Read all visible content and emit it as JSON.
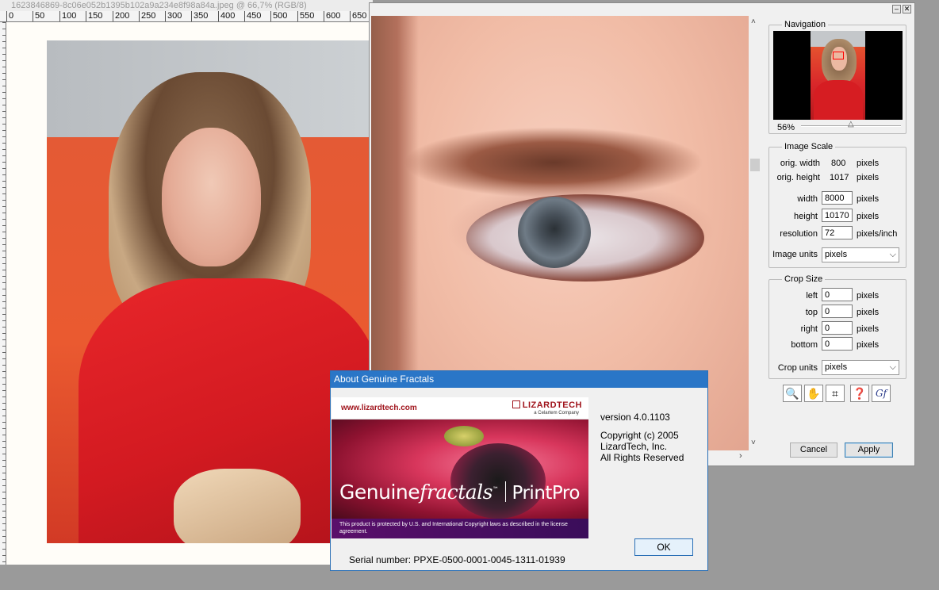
{
  "document": {
    "title": "1623846869-8c06e052b1395b102a9a234e8f98a84a.jpeg @ 66,7% (RGB/8)",
    "ruler_labels": [
      "0",
      "50",
      "100",
      "150",
      "200",
      "250",
      "300",
      "350",
      "400",
      "450",
      "500",
      "550",
      "600",
      "650"
    ]
  },
  "gf_window": {
    "navigation": {
      "label": "Navigation",
      "zoom": "56%"
    },
    "image_scale": {
      "label": "Image Scale",
      "orig_width_label": "orig. width",
      "orig_width_value": "800",
      "orig_width_unit": "pixels",
      "orig_height_label": "orig. height",
      "orig_height_value": "1017",
      "orig_height_unit": "pixels",
      "width_label": "width",
      "width_value": "8000",
      "width_unit": "pixels",
      "height_label": "height",
      "height_value": "10170",
      "height_unit": "pixels",
      "resolution_label": "resolution",
      "resolution_value": "72",
      "resolution_unit": "pixels/inch",
      "units_label": "Image units",
      "units_value": "pixels"
    },
    "crop_size": {
      "label": "Crop Size",
      "left_label": "left",
      "left_value": "0",
      "top_label": "top",
      "top_value": "0",
      "right_label": "right",
      "right_value": "0",
      "bottom_label": "bottom",
      "bottom_value": "0",
      "unit": "pixels",
      "units_label": "Crop units",
      "units_value": "pixels"
    },
    "tools": {
      "zoom_icon": "🔍",
      "hand_icon": "✋",
      "crop_icon": "⌗",
      "help_icon": "❓",
      "gf_icon": "Gf"
    },
    "buttons": {
      "cancel": "Cancel",
      "apply": "Apply"
    }
  },
  "about": {
    "title": "About Genuine Fractals",
    "banner": {
      "url": "www.lizardtech.com",
      "logo": "LIZARDTECH",
      "logo_sub": "a Celartem Company",
      "brand_start": "Genuine",
      "brand_italic": "fractals",
      "brand_mark": "™",
      "product": "PrintPro",
      "legal": "This product is protected by U.S. and International Copyright laws as described in the license agreement."
    },
    "version": "version 4.0.1103",
    "copyright_line1": "Copyright (c) 2005",
    "copyright_line2": "LizardTech, Inc.",
    "copyright_line3": "All Rights Reserved",
    "ok": "OK",
    "serial": "Serial number:  PPXE-0500-0001-0045-1311-01939"
  }
}
